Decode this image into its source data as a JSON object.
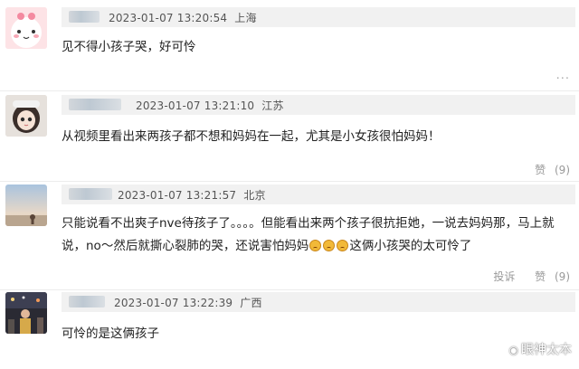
{
  "comments": [
    {
      "timestamp": "2023-01-07 13:20:54",
      "location": "上海",
      "text": "见不得小孩子哭，好可怜",
      "more": "···"
    },
    {
      "timestamp": "2023-01-07 13:21:10",
      "location": "江苏",
      "text": "从视频里看出来两孩子都不想和妈妈在一起，尤其是小女孩很怕妈妈！",
      "like_label": "赞",
      "like_count": "(9)"
    },
    {
      "timestamp": "2023-01-07 13:21:57",
      "location": "北京",
      "text_line1": "只能说看不出爽子nve待孩子了。。。。但能看出来两个孩子很抗拒她，一说去妈妈那，马上就",
      "text_line2a": "说，no～然后就撕心裂肺的哭，还说害怕妈妈",
      "text_line2b": "这俩小孩哭的太可怜了",
      "report_label": "投诉",
      "like_label": "赞",
      "like_count": "(9)"
    },
    {
      "timestamp": "2023-01-07 13:22:39",
      "location": "广西",
      "text": "可怜的是这俩孩子"
    }
  ],
  "watermark": "眼神太本",
  "colors": {
    "meta_bar": "#f1f1f1",
    "text": "#222222",
    "muted": "#999999"
  }
}
